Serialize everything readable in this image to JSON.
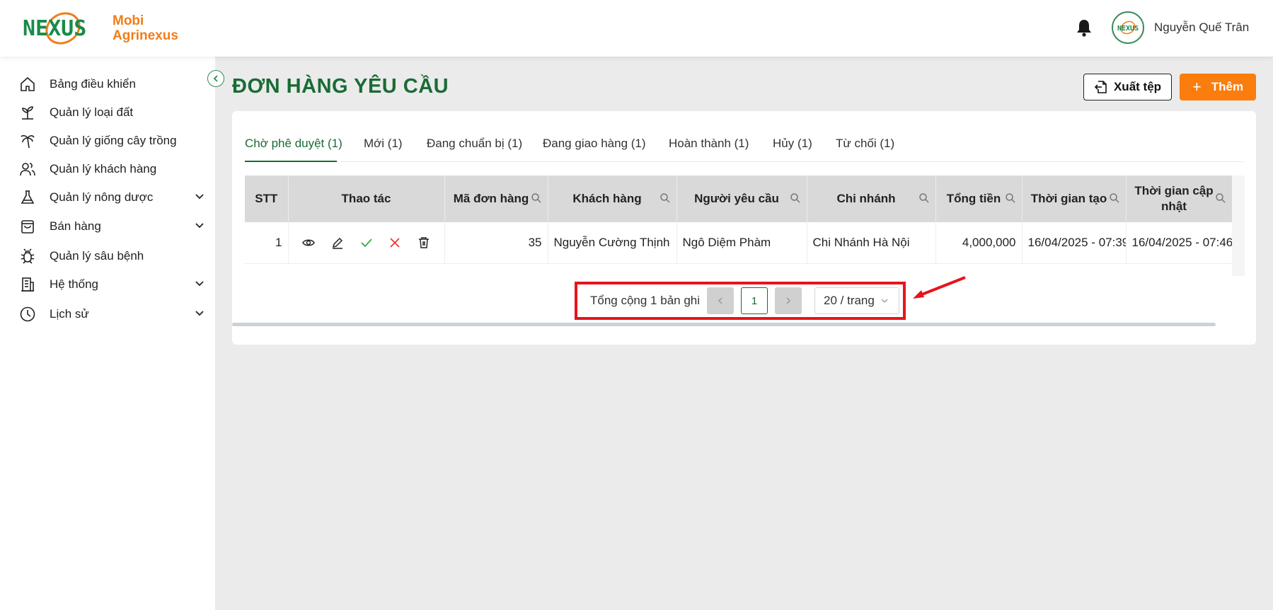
{
  "app": {
    "logo_text_line1": "Mobi",
    "logo_text_line2": "Agrinexus",
    "logo_mark_text": "NEXUS",
    "user_name": "Nguyễn Quế Trân",
    "avatar_text": "NEXUS"
  },
  "sidebar": {
    "items": [
      {
        "label": "Bảng điều khiển",
        "icon": "home-icon",
        "has_children": false
      },
      {
        "label": "Quản lý loại đất",
        "icon": "sprout-icon",
        "has_children": false
      },
      {
        "label": "Quản lý giống cây trồng",
        "icon": "palm-tree-icon",
        "has_children": false
      },
      {
        "label": "Quản lý khách hàng",
        "icon": "users-icon",
        "has_children": false
      },
      {
        "label": "Quản lý nông dược",
        "icon": "flask-icon",
        "has_children": true
      },
      {
        "label": "Bán hàng",
        "icon": "shopping-bag-icon",
        "has_children": true
      },
      {
        "label": "Quản lý sâu bệnh",
        "icon": "bug-icon",
        "has_children": false
      },
      {
        "label": "Hệ thống",
        "icon": "building-icon",
        "has_children": true
      },
      {
        "label": "Lịch sử",
        "icon": "clock-icon",
        "has_children": true
      }
    ]
  },
  "page": {
    "title": "ĐƠN HÀNG YÊU CẦU",
    "export_label": "Xuất tệp",
    "add_label": "Thêm"
  },
  "tabs": [
    {
      "label": "Chờ phê duyệt (1)",
      "active": true
    },
    {
      "label": "Mới (1)",
      "active": false
    },
    {
      "label": "Đang chuẩn bị (1)",
      "active": false
    },
    {
      "label": "Đang giao hàng (1)",
      "active": false
    },
    {
      "label": "Hoàn thành (1)",
      "active": false
    },
    {
      "label": "Hủy (1)",
      "active": false
    },
    {
      "label": "Từ chối (1)",
      "active": false
    }
  ],
  "table": {
    "columns": [
      "STT",
      "Thao tác",
      "Mã đơn hàng",
      "Khách hàng",
      "Người yêu cầu",
      "Chi nhánh",
      "Tổng tiền",
      "Thời gian tạo",
      "Thời gian cập nhật"
    ],
    "rows": [
      {
        "stt": "1",
        "order_id": "35",
        "customer": "Nguyễn Cường Thịnh",
        "requester": "Ngô Diệm Phàm",
        "branch": "Chi Nhánh Hà Nội",
        "total": "4,000,000",
        "created": "16/04/2025 - 07:39",
        "updated": "16/04/2025 - 07:46"
      }
    ]
  },
  "pagination": {
    "total_text": "Tổng cộng 1 bản ghi",
    "current_page": "1",
    "page_size": "20 / trang"
  },
  "colors": {
    "brand_green": "#1a6b35",
    "accent_orange": "#fa7d0e",
    "highlight_red": "#e8131b",
    "main_bg": "#ebebeb"
  }
}
